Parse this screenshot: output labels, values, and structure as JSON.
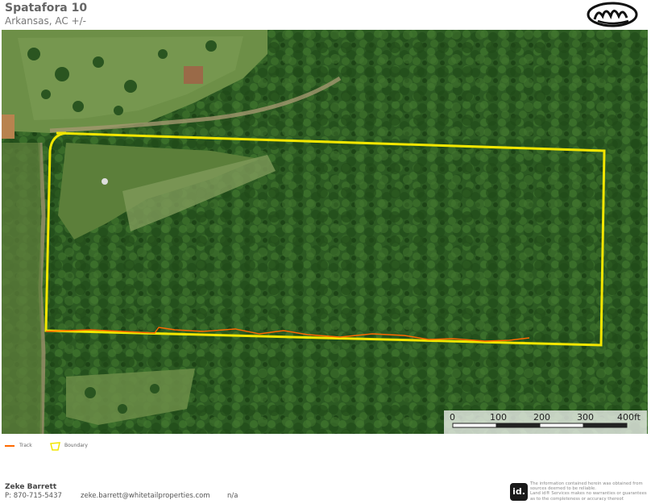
{
  "header": {
    "title": "Spatafora 10",
    "subtitle": "Arkansas,  AC +/-"
  },
  "map": {
    "scale_labels": [
      "0",
      "100",
      "200",
      "300",
      "400ft"
    ],
    "boundary_color": "#f2e600",
    "track_color": "#ff6a00"
  },
  "legend": {
    "track_label": "Track",
    "boundary_label": "Boundary"
  },
  "footer": {
    "agent_name": "Zeke Barrett",
    "phone": "P: 870-715-5437",
    "email": "zeke.barrett@whitetailproperties.com",
    "extra": "n/a",
    "badge": "id.",
    "disclaimer": [
      "The information contained herein was obtained from",
      "sources deemed to be reliable.",
      "Land id® Services makes no warranties or guarantees",
      "as to the completeness or accuracy thereof."
    ]
  }
}
